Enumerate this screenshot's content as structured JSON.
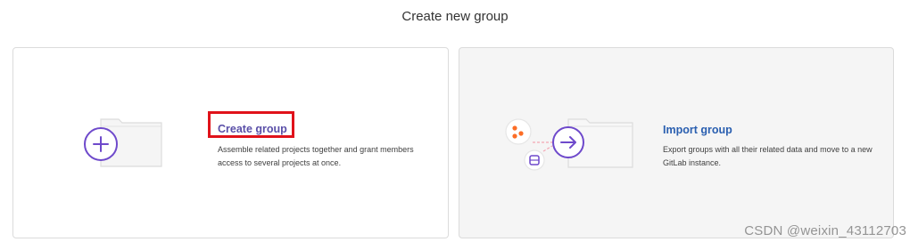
{
  "page": {
    "title": "Create new group"
  },
  "cards": {
    "create": {
      "title": "Create group",
      "description": "Assemble related projects together and grant members access to several projects at once."
    },
    "import": {
      "title": "Import group",
      "description": "Export groups with all their related data and move to a new GitLab instance."
    }
  },
  "icons": {
    "create_illustration": "folder-plus-icon",
    "import_illustration": "folder-import-arrow-icon"
  },
  "colors": {
    "accent_purple": "#6e49cb",
    "highlight_red": "#e0121a",
    "import_link_blue": "#2a5fb0",
    "gitlab_orange": "#fc6d26"
  },
  "watermark": "CSDN @weixin_43112703"
}
